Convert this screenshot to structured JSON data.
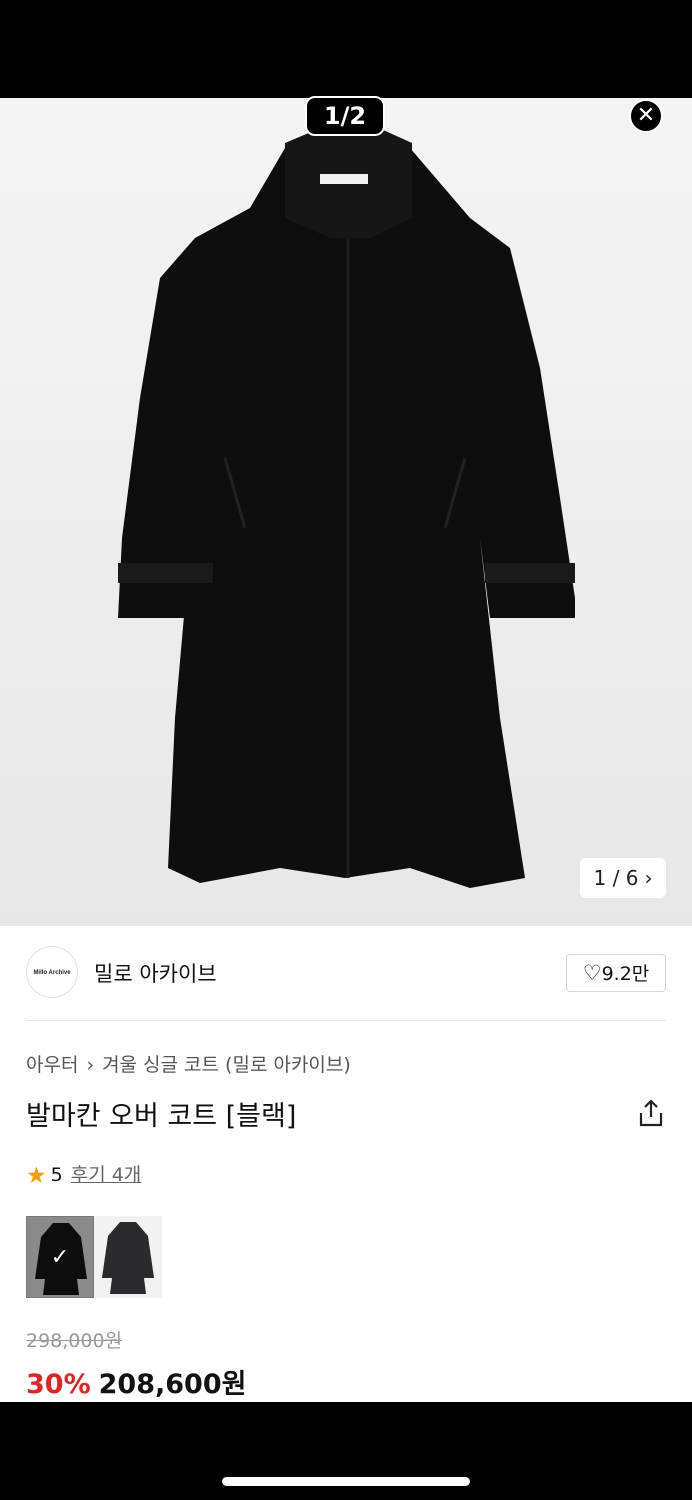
{
  "viewer": {
    "counter": "1/2",
    "close_glyph": "✕"
  },
  "hero": {
    "image_counter": "1 / 6",
    "next_glyph": "›",
    "image_alt": "black coat"
  },
  "brand": {
    "logo_text": "Millo Archive",
    "name": "밀로 아카이브",
    "likes": "9.2만"
  },
  "breadcrumb": {
    "category": "아우터",
    "separator": "›",
    "subcategory": "겨울 싱글 코트 (밀로 아카이브)"
  },
  "product": {
    "title": "발마칸 오버 코트 [블랙]",
    "rating": "5",
    "reviews": "후기 4개",
    "original_price": "298,000원",
    "discount": "30%",
    "sale_price": "208,600원",
    "colors": [
      "black",
      "charcoal"
    ]
  },
  "colors": {
    "accent_red": "#e02424",
    "star": "#f59e0b"
  }
}
